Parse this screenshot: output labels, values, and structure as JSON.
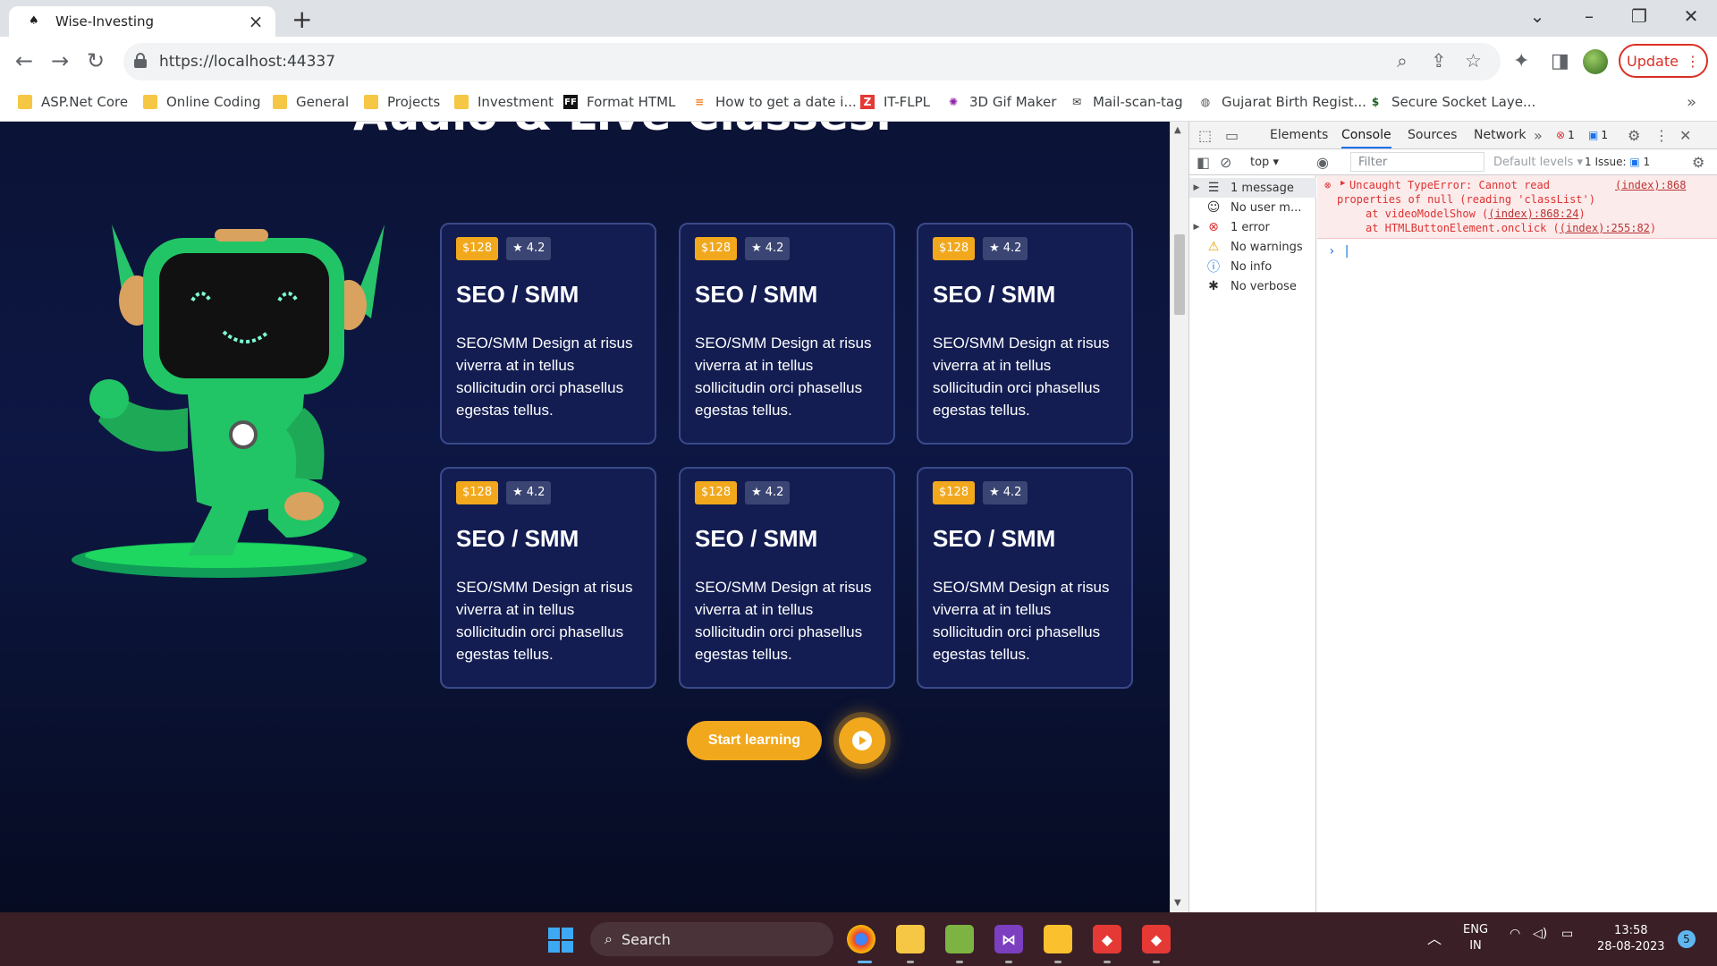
{
  "browser": {
    "tab_title": "Wise-Investing",
    "url": "https://localhost:44337",
    "update_label": "Update",
    "bookmarks": [
      {
        "label": "ASP.Net Core",
        "icon": "folder-icon"
      },
      {
        "label": "Online Coding",
        "icon": "folder-icon"
      },
      {
        "label": "General",
        "icon": "folder-icon"
      },
      {
        "label": "Projects",
        "icon": "folder-icon"
      },
      {
        "label": "Investment",
        "icon": "folder-icon"
      },
      {
        "label": "Format HTML",
        "icon": "ff-icon"
      },
      {
        "label": "How to get a date i...",
        "icon": "stack-icon"
      },
      {
        "label": "IT-FLPL",
        "icon": "z-icon"
      },
      {
        "label": "3D Gif Maker",
        "icon": "pinwheel-icon"
      },
      {
        "label": "Mail-scan-tag",
        "icon": "mail-icon"
      },
      {
        "label": "Gujarat Birth Regist...",
        "icon": "globe-icon"
      },
      {
        "label": "Secure Socket Laye...",
        "icon": "dollar-icon"
      }
    ]
  },
  "page": {
    "heading": "Audio & Live Classes.",
    "cards": [
      {
        "price": "$128",
        "rating": "4.2",
        "title": "SEO / SMM",
        "description": "SEO/SMM Design at risus viverra at in tellus sollicitudin orci phasellus egestas tellus."
      },
      {
        "price": "$128",
        "rating": "4.2",
        "title": "SEO / SMM",
        "description": "SEO/SMM Design at risus viverra at in tellus sollicitudin orci phasellus egestas tellus."
      },
      {
        "price": "$128",
        "rating": "4.2",
        "title": "SEO / SMM",
        "description": "SEO/SMM Design at risus viverra at in tellus sollicitudin orci phasellus egestas tellus."
      },
      {
        "price": "$128",
        "rating": "4.2",
        "title": "SEO / SMM",
        "description": "SEO/SMM Design at risus viverra at in tellus sollicitudin orci phasellus egestas tellus."
      },
      {
        "price": "$128",
        "rating": "4.2",
        "title": "SEO / SMM",
        "description": "SEO/SMM Design at risus viverra at in tellus sollicitudin orci phasellus egestas tellus."
      },
      {
        "price": "$128",
        "rating": "4.2",
        "title": "SEO / SMM",
        "description": "SEO/SMM Design at risus viverra at in tellus sollicitudin orci phasellus egestas tellus."
      }
    ],
    "start_label": "Start learning",
    "colors": {
      "accent": "#f2a81d",
      "background": "#0d1743",
      "card": "#131d52"
    }
  },
  "devtools": {
    "tabs": [
      "Elements",
      "Console",
      "Sources",
      "Network"
    ],
    "active_tab": "Console",
    "error_count": "1",
    "message_count": "1",
    "context": "top",
    "filter_placeholder": "Filter",
    "levels": "Default levels",
    "issues_label": "1 Issue:",
    "issues_count": "1",
    "sidebar": [
      "1 message",
      "No user m...",
      "1 error",
      "No warnings",
      "No info",
      "No verbose"
    ],
    "error": {
      "line1": "Uncaught TypeError: Cannot read",
      "link1": "(index):868",
      "line2": "properties of null (reading 'classList')",
      "line3_prefix": "at videoModelShow (",
      "line3_link": "(index):868:24",
      "line3_suffix": ")",
      "line4_prefix": "at HTMLButtonElement.onclick (",
      "line4_link": "(index):255:82",
      "line4_suffix": ")"
    }
  },
  "taskbar": {
    "search_label": "Search",
    "lang_line1": "ENG",
    "lang_line2": "IN",
    "time": "13:58",
    "date": "28-08-2023",
    "notification_count": "5"
  }
}
